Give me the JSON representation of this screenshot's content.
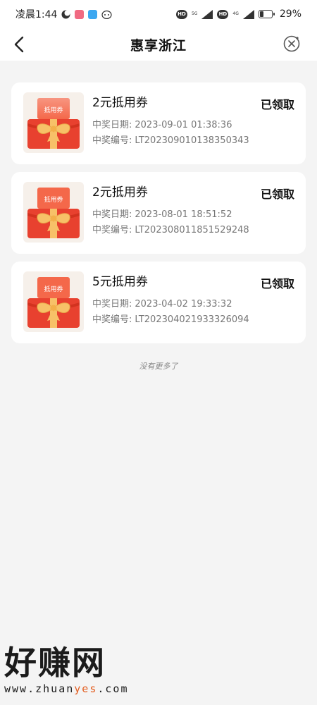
{
  "status_bar": {
    "time": "凌晨1:44",
    "network_a": "5G",
    "network_b": "4G",
    "hd_a": "HD",
    "hd_b": "HD",
    "battery": "29%",
    "battery_level": 0.29
  },
  "nav": {
    "title": "惠享浙江"
  },
  "coupons": [
    {
      "title": "2元抵用券",
      "status": "已领取",
      "date_label": "中奖日期:",
      "date": "2023-09-01 01:38:36",
      "no_label": "中奖编号:",
      "no": "LT202309010138350343",
      "image_text": "抵用券"
    },
    {
      "title": "2元抵用券",
      "status": "已领取",
      "date_label": "中奖日期:",
      "date": "2023-08-01 18:51:52",
      "no_label": "中奖编号:",
      "no": "LT202308011851529248",
      "image_text": "抵用券"
    },
    {
      "title": "5元抵用券",
      "status": "已领取",
      "date_label": "中奖日期:",
      "date": "2023-04-02 19:33:32",
      "no_label": "中奖编号:",
      "no": "LT202304021933326094",
      "image_text": "抵用券"
    }
  ],
  "footer": {
    "no_more": "没有更多了"
  },
  "watermark": {
    "text": "好赚网",
    "url_part1": "www.zhuan",
    "url_part2": "yes",
    "url_part3": ".com"
  },
  "colors": {
    "accent": "#e8412f",
    "ribbon": "#f7c168"
  },
  "icons": {
    "back": "chevron-left-icon",
    "close": "close-circle-icon"
  }
}
